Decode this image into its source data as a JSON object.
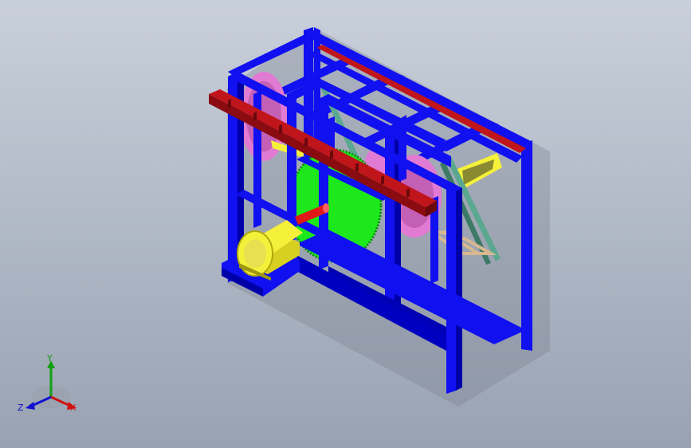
{
  "viewport": {
    "background_top": "#c9d0db",
    "background_bottom": "#98a2b2"
  },
  "model": {
    "frame_color": "#1010f0",
    "top_beam_color": "#c0151a",
    "gear_color": "#e07ad2",
    "saw_blade_color": "#1ce81c",
    "motor_color": "#f5f03a",
    "drive_shaft_color": "#e01818",
    "belt_color": "#5aa890",
    "bracket_color": "#d8b890"
  },
  "triad": {
    "x_label": "X",
    "y_label": "Y",
    "z_label": "Z",
    "x_color": "#d01010",
    "y_color": "#10a010",
    "z_color": "#1010d0"
  }
}
